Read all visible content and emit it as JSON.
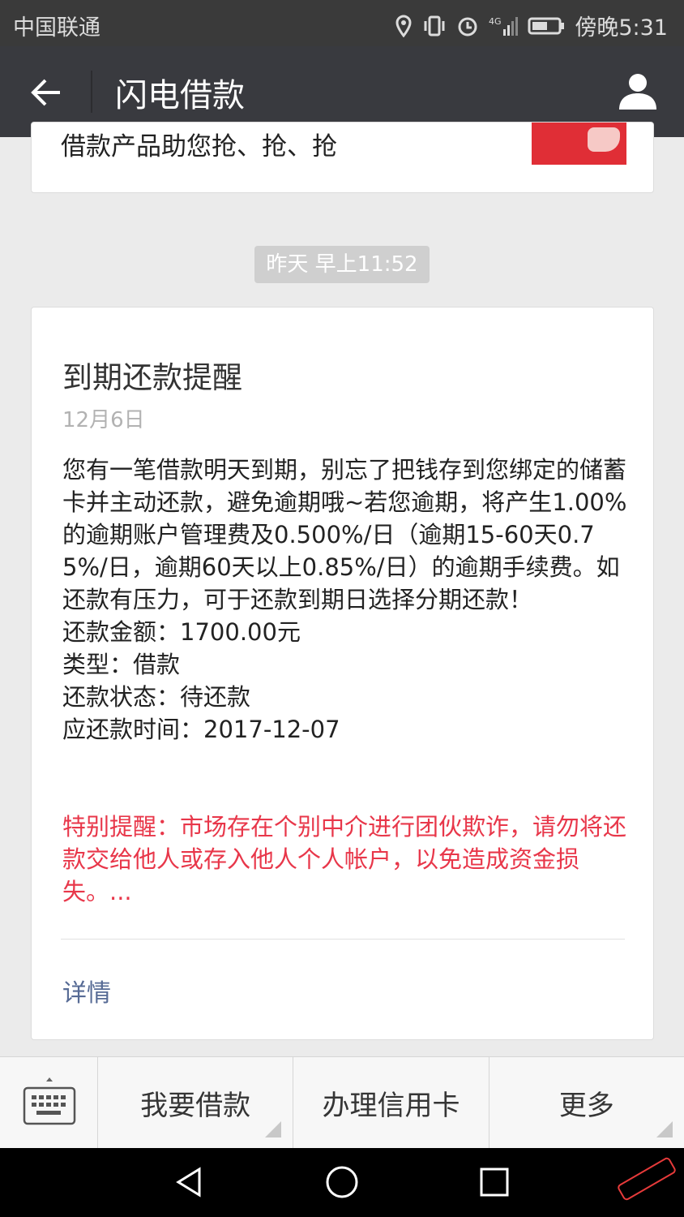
{
  "status_bar": {
    "carrier": "中国联通",
    "time": "傍晚5:31",
    "network": "4G"
  },
  "header": {
    "title": "闪电借款",
    "back_icon": "arrow-left-icon",
    "profile_icon": "person-icon"
  },
  "previous_card": {
    "text_fragment": "借款产品助您抢、抢、抢"
  },
  "timestamp": "昨天 早上11:52",
  "message": {
    "title": "到期还款提醒",
    "date": "12月6日",
    "body": "您有一笔借款明天到期，别忘了把钱存到您绑定的储蓄卡并主动还款，避免逾期哦~若您逾期，将产生1.00%的逾期账户管理费及0.500%/日（逾期15-60天0.75%/日，逾期60天以上0.85%/日）的逾期手续费。如还款有压力，可于还款到期日选择分期还款！",
    "fields": [
      {
        "label": "还款金额：",
        "value": "1700.00元"
      },
      {
        "label": "类型：",
        "value": "借款"
      },
      {
        "label": "还款状态：",
        "value": "待还款"
      },
      {
        "label": "应还款时间：",
        "value": "2017-12-07"
      }
    ],
    "warning": "特别提醒：市场存在个别中介进行团伙欺诈，请勿将还款交给他人或存入他人个人帐户，以免造成资金损失。...",
    "detail_link": "详情"
  },
  "bottom_menu": {
    "keyboard_icon": "keyboard-icon",
    "items": [
      "我要借款",
      "办理信用卡",
      "更多"
    ]
  },
  "colors": {
    "title_bar": "#393a3f",
    "warning_text": "#e8374a",
    "link": "#576b95"
  }
}
